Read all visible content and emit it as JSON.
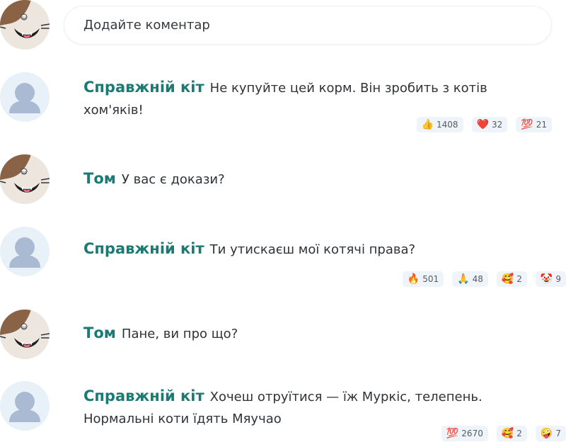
{
  "comment_input": {
    "placeholder": "Додайте коментар"
  },
  "messages": [
    {
      "author": "Справжній кіт",
      "text": "Не купуйте цей корм. Він зробить з котів хом'яків!",
      "reactions": [
        {
          "icon": "👍",
          "count": "1408"
        },
        {
          "icon": "❤️",
          "count": "32"
        },
        {
          "icon": "💯",
          "count": "21"
        }
      ]
    },
    {
      "author": "Том",
      "text": "У вас є докази?"
    },
    {
      "author": "Справжній кіт",
      "text": "Ти утискаєш мої котячі права?",
      "reactions": [
        {
          "icon": "🔥",
          "count": "501"
        },
        {
          "icon": "🙏",
          "count": "48"
        },
        {
          "icon": "🥰",
          "count": "2"
        },
        {
          "icon": "🤡",
          "count": "9"
        }
      ]
    },
    {
      "author": "Том",
      "text": "Пане, ви про що?"
    },
    {
      "author": "Справжній кіт",
      "text": "Хочеш отруїтися — їж Муркіс, телепень. Нормальні коти їдять Мяучао",
      "reactions": [
        {
          "icon": "💯",
          "count": "2670"
        },
        {
          "icon": "🥰",
          "count": "2"
        },
        {
          "icon": "🤪",
          "count": "7"
        }
      ]
    }
  ]
}
